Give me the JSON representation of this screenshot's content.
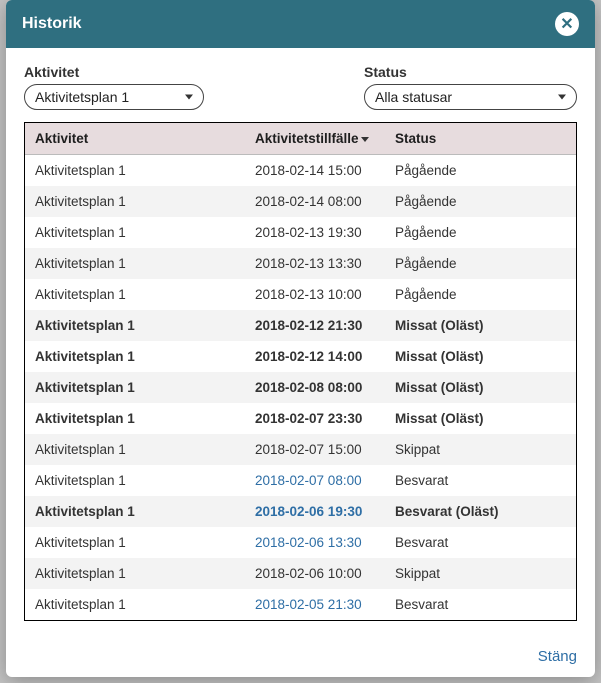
{
  "header": {
    "title": "Historik"
  },
  "filters": {
    "activity": {
      "label": "Aktivitet",
      "value": "Aktivitetsplan 1"
    },
    "status": {
      "label": "Status",
      "value": "Alla statusar"
    }
  },
  "table": {
    "headers": {
      "activity": "Aktivitet",
      "time": "Aktivitetstillfälle",
      "status": "Status"
    },
    "rows": [
      {
        "activity": "Aktivitetsplan 1",
        "time": "2018-02-14 15:00",
        "status": "Pågående",
        "bold": false,
        "link": false,
        "alt": false
      },
      {
        "activity": "Aktivitetsplan 1",
        "time": "2018-02-14 08:00",
        "status": "Pågående",
        "bold": false,
        "link": false,
        "alt": true
      },
      {
        "activity": "Aktivitetsplan 1",
        "time": "2018-02-13 19:30",
        "status": "Pågående",
        "bold": false,
        "link": false,
        "alt": false
      },
      {
        "activity": "Aktivitetsplan 1",
        "time": "2018-02-13 13:30",
        "status": "Pågående",
        "bold": false,
        "link": false,
        "alt": true
      },
      {
        "activity": "Aktivitetsplan 1",
        "time": "2018-02-13 10:00",
        "status": "Pågående",
        "bold": false,
        "link": false,
        "alt": false
      },
      {
        "activity": "Aktivitetsplan 1",
        "time": "2018-02-12 21:30",
        "status": "Missat (Oläst)",
        "bold": true,
        "link": false,
        "alt": true
      },
      {
        "activity": "Aktivitetsplan 1",
        "time": "2018-02-12 14:00",
        "status": "Missat (Oläst)",
        "bold": true,
        "link": false,
        "alt": false
      },
      {
        "activity": "Aktivitetsplan 1",
        "time": "2018-02-08 08:00",
        "status": "Missat (Oläst)",
        "bold": true,
        "link": false,
        "alt": true
      },
      {
        "activity": "Aktivitetsplan 1",
        "time": "2018-02-07 23:30",
        "status": "Missat (Oläst)",
        "bold": true,
        "link": false,
        "alt": false
      },
      {
        "activity": "Aktivitetsplan 1",
        "time": "2018-02-07 15:00",
        "status": "Skippat",
        "bold": false,
        "link": false,
        "alt": true
      },
      {
        "activity": "Aktivitetsplan 1",
        "time": "2018-02-07 08:00",
        "status": "Besvarat",
        "bold": false,
        "link": true,
        "alt": false
      },
      {
        "activity": "Aktivitetsplan 1",
        "time": "2018-02-06 19:30",
        "status": "Besvarat (Oläst)",
        "bold": true,
        "link": true,
        "alt": true
      },
      {
        "activity": "Aktivitetsplan 1",
        "time": "2018-02-06 13:30",
        "status": "Besvarat",
        "bold": false,
        "link": true,
        "alt": false
      },
      {
        "activity": "Aktivitetsplan 1",
        "time": "2018-02-06 10:00",
        "status": "Skippat",
        "bold": false,
        "link": false,
        "alt": true
      },
      {
        "activity": "Aktivitetsplan 1",
        "time": "2018-02-05 21:30",
        "status": "Besvarat",
        "bold": false,
        "link": true,
        "alt": false
      }
    ]
  },
  "footer": {
    "close": "Stäng"
  }
}
